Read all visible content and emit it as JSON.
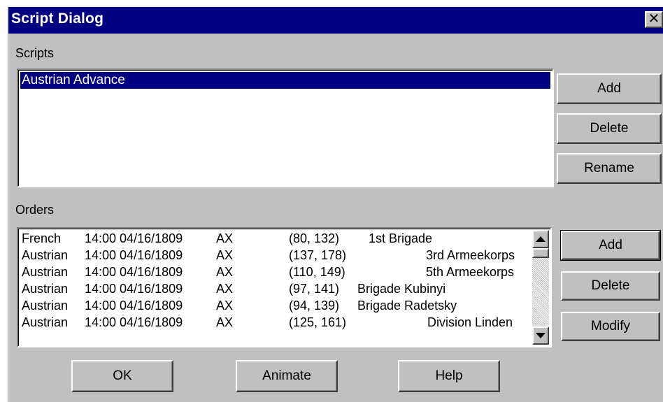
{
  "window": {
    "title": "Script Dialog",
    "close_glyph": "✕"
  },
  "scripts": {
    "label": "Scripts",
    "items": [
      "Austrian Advance"
    ],
    "buttons": {
      "add": "Add",
      "delete": "Delete",
      "rename": "Rename"
    }
  },
  "orders": {
    "label": "Orders",
    "rows": [
      {
        "side": "French",
        "time": "14:00 04/16/1809",
        "code": "AX",
        "coord": "(80, 132)",
        "unit": "1st Brigade"
      },
      {
        "side": "Austrian",
        "time": "14:00 04/16/1809",
        "code": "AX",
        "coord": "(137, 178)",
        "unit": "3rd Armeekorps"
      },
      {
        "side": "Austrian",
        "time": "14:00 04/16/1809",
        "code": "AX",
        "coord": "(110, 149)",
        "unit": "5th Armeekorps"
      },
      {
        "side": "Austrian",
        "time": "14:00 04/16/1809",
        "code": "AX",
        "coord": "(97, 141)",
        "unit": "Brigade Kubinyi"
      },
      {
        "side": "Austrian",
        "time": "14:00 04/16/1809",
        "code": "AX",
        "coord": "(94, 139)",
        "unit": "Brigade Radetsky"
      },
      {
        "side": "Austrian",
        "time": "14:00 04/16/1809",
        "code": "AX",
        "coord": "(125, 161)",
        "unit": "Division Linden"
      }
    ],
    "buttons": {
      "add": "Add",
      "delete": "Delete",
      "modify": "Modify"
    }
  },
  "footer": {
    "ok": "OK",
    "animate": "Animate",
    "help": "Help"
  },
  "icons": {
    "close": "close-icon",
    "scroll_up": "scroll-up-arrow-icon",
    "scroll_down": "scroll-down-arrow-icon"
  },
  "colors": {
    "titlebar": "#000080",
    "face": "#c0c0c0",
    "selection": "#000080"
  }
}
